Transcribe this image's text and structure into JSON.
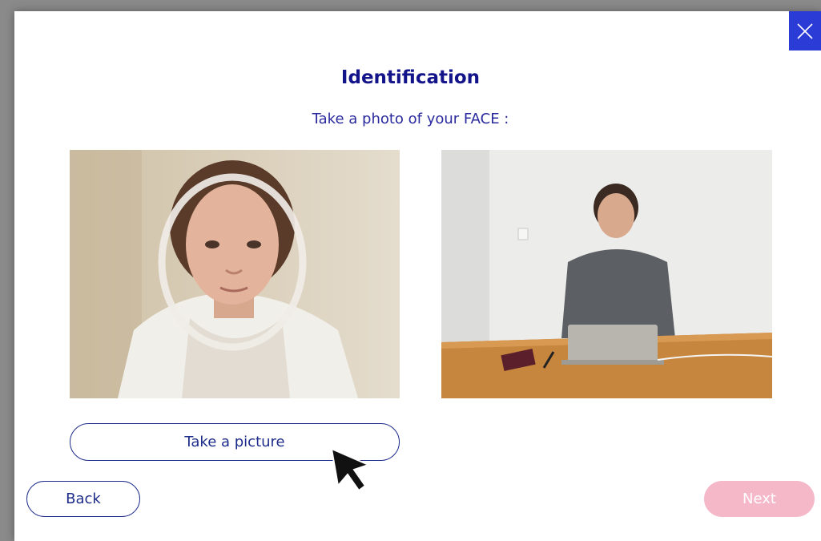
{
  "dialog": {
    "title": "Identification",
    "subtitle": "Take a photo of your FACE :"
  },
  "photos": {
    "left": {
      "description_icon": "webcam-face-preview",
      "overlay": "face-oval-guide"
    },
    "right": {
      "description_icon": "person-at-laptop-photo"
    }
  },
  "buttons": {
    "take_picture": "Take a picture",
    "back": "Back",
    "next": "Next",
    "close_icon": "close-icon"
  },
  "colors": {
    "accent": "#2b3bd6",
    "title": "#13138a",
    "next_disabled": "#f5b8c9"
  }
}
